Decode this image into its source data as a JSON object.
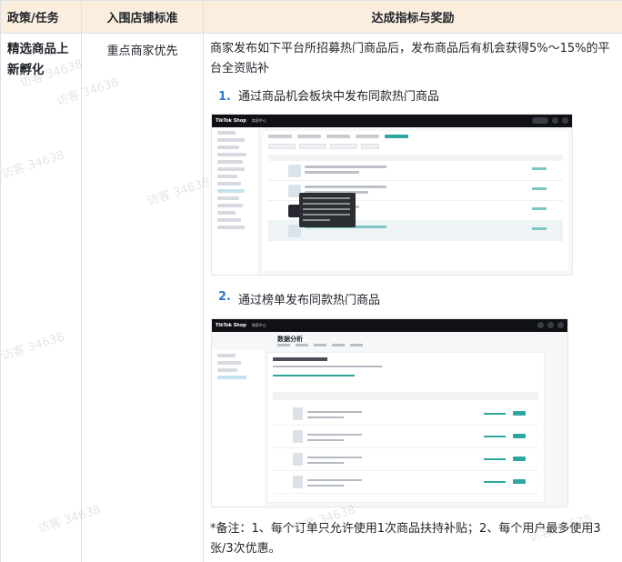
{
  "table": {
    "headers": [
      "政策/任务",
      "入围店铺标准",
      "达成指标与奖励"
    ],
    "policy_name": "精选商品上新孵化",
    "standard": "重点商家优先",
    "intro": "商家发布如下平台所招募热门商品后，发布商品后有机会获得5%～15%的平台全资贴补",
    "steps": [
      {
        "num": "1.",
        "text": "通过商品机会板块中发布同款热门商品"
      },
      {
        "num": "2.",
        "text": "通过榜单发布同款热门商品"
      }
    ],
    "note": "*备注：1、每个订单只允许使用1次商品扶持补贴；2、每个用户最多使用3张/3次优惠。"
  },
  "screenshot1": {
    "brand": "TikTok Shop",
    "nav": "商家中心"
  },
  "screenshot2": {
    "brand": "TikTok Shop",
    "nav": "商家中心",
    "page_title": "数据分析"
  },
  "watermark": "访客 34638",
  "colors": {
    "header_bg": "#fbeedf",
    "border": "#dee0e3",
    "step_number": "#2d7bd6",
    "accent_teal": "#2ea7a0"
  }
}
